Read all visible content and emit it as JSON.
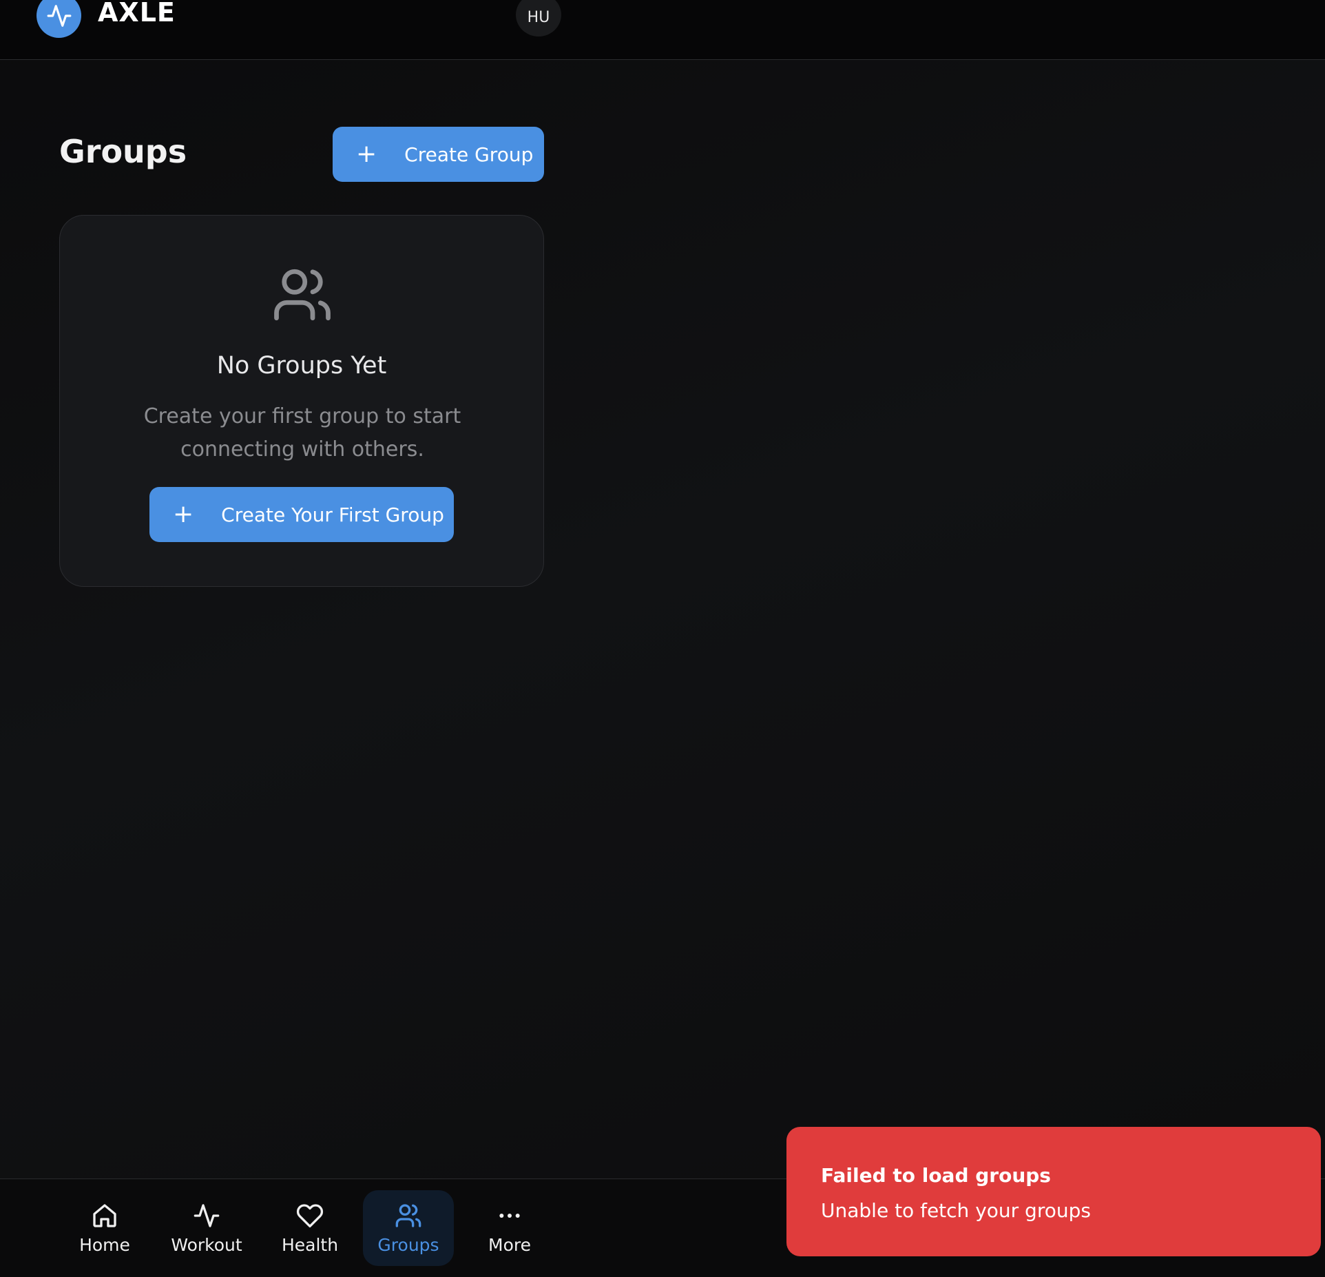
{
  "header": {
    "brand": "AXLE",
    "avatar_initials": "HU",
    "accent_color": "#4a90e2",
    "logo_icon": "activity-icon"
  },
  "page": {
    "title": "Groups",
    "create_button_label": "Create Group",
    "create_button_icon": "plus-icon"
  },
  "empty_state": {
    "icon": "users-icon",
    "title": "No Groups Yet",
    "description": "Create your first group to start connecting with others.",
    "button_label": "Create Your First Group"
  },
  "nav": {
    "items": [
      {
        "label": "Home",
        "icon": "home-icon",
        "active": false
      },
      {
        "label": "Workout",
        "icon": "activity-icon",
        "active": false
      },
      {
        "label": "Health",
        "icon": "heart-icon",
        "active": false
      },
      {
        "label": "Groups",
        "icon": "users-icon",
        "active": true
      },
      {
        "label": "More",
        "icon": "more-horizontal-icon",
        "active": false
      }
    ]
  },
  "toast": {
    "title": "Failed to load groups",
    "description": "Unable to fetch your groups",
    "color": "#e03c3c"
  }
}
